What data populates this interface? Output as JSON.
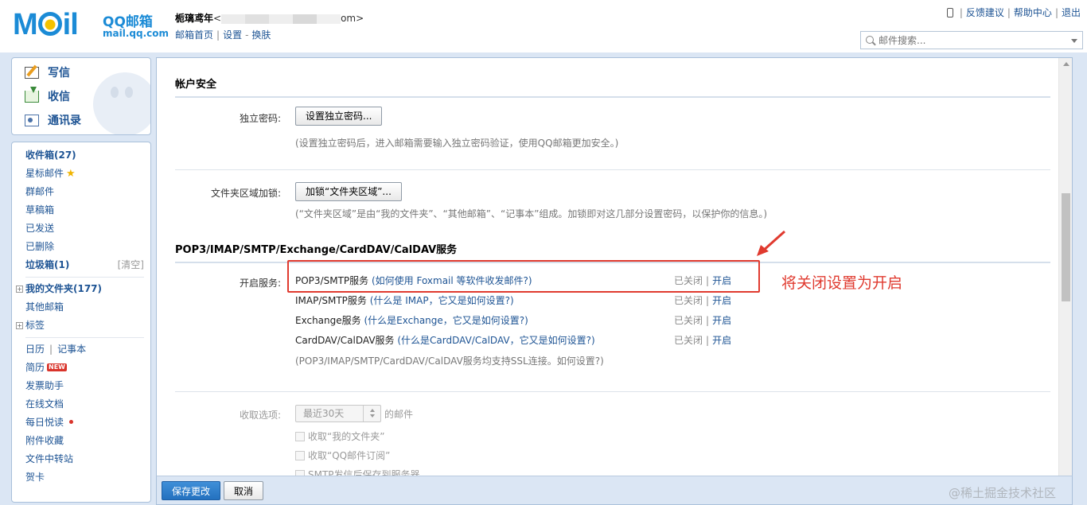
{
  "header": {
    "logo": {
      "brand": "QQ邮箱",
      "domain": "mail.qq.com"
    },
    "user": {
      "name": "栀璃鸢年",
      "email_prefix": "<",
      "email_suffix": "om>"
    },
    "user_links": {
      "home": "邮箱首页",
      "settings": "设置",
      "skin": "换肤",
      "sep": "|",
      "dash": "-"
    },
    "top_links": {
      "feedback": "反馈建议",
      "help": "帮助中心",
      "logout": "退出",
      "sep": "|"
    },
    "search": {
      "placeholder": "邮件搜索..."
    }
  },
  "nav_top": {
    "compose": "写信",
    "inbox": "收信",
    "contacts": "通讯录"
  },
  "nav_folders": {
    "inbox": "收件箱(27)",
    "starred": "星标邮件",
    "group": "群邮件",
    "drafts": "草稿箱",
    "sent": "已发送",
    "deleted": "已删除",
    "spam": "垃圾箱(1)",
    "spam_clear": "[清空]",
    "my_folders": "我的文件夹(177)",
    "other_mailboxes": "其他邮箱",
    "tags": "标签",
    "calendar": "日历",
    "notes": "记事本",
    "resume": "简历",
    "resume_badge": "NEW",
    "invoice": "发票助手",
    "docs": "在线文档",
    "daily": "每日悦读",
    "attachments": "附件收藏",
    "transfer": "文件中转站",
    "cards": "贺卡",
    "expander_plus": "+",
    "pipe": "|"
  },
  "account_security": {
    "title": "帐户安全",
    "independent_password_label": "独立密码:",
    "independent_password_button": "设置独立密码...",
    "independent_password_hint": "(设置独立密码后，进入邮箱需要输入独立密码验证，使用QQ邮箱更加安全。)",
    "folder_lock_label": "文件夹区域加锁:",
    "folder_lock_button": "加锁“文件夹区域”...",
    "folder_lock_hint": "(“文件夹区域”是由“我的文件夹”、“其他邮箱”、“记事本”组成。加锁即对这几部分设置密码，以保护你的信息。)"
  },
  "services": {
    "title": "POP3/IMAP/SMTP/Exchange/CardDAV/CalDAV服务",
    "enable_label": "开启服务:",
    "rows": [
      {
        "name": "POP3/SMTP服务",
        "help": "(如何使用 Foxmail 等软件收发邮件?)",
        "status": "已关闭",
        "action": "开启"
      },
      {
        "name": "IMAP/SMTP服务",
        "help": "(什么是 IMAP，它又是如何设置?)",
        "status": "已关闭",
        "action": "开启"
      },
      {
        "name": "Exchange服务",
        "help": "(什么是Exchange，它又是如何设置?)",
        "status": "已关闭",
        "action": "开启"
      },
      {
        "name": "CardDAV/CalDAV服务",
        "help": "(什么是CardDAV/CalDAV，它又是如何设置?)",
        "status": "已关闭",
        "action": "开启"
      }
    ],
    "status_sep": "|",
    "ssl_hint": "(POP3/IMAP/SMTP/CardDAV/CalDAV服务均支持SSL连接。如何设置?)"
  },
  "receive_options": {
    "label": "收取选项:",
    "select_value": "最近30天",
    "suffix": "的邮件",
    "checkbox_1": "收取“我的文件夹”",
    "checkbox_2": "收取“QQ邮件订阅”",
    "checkbox_3": "SMTP发信后保存到服务器"
  },
  "annotation": {
    "text": "将关闭设置为开启"
  },
  "footer": {
    "save": "保存更改",
    "cancel": "取消",
    "watermark": "@稀土掘金技术社区"
  },
  "colors": {
    "link": "#1e5494",
    "frame_bg": "#dbe6f4",
    "annotation_red": "#e03a2f",
    "save_button": "#2d7fcd"
  }
}
